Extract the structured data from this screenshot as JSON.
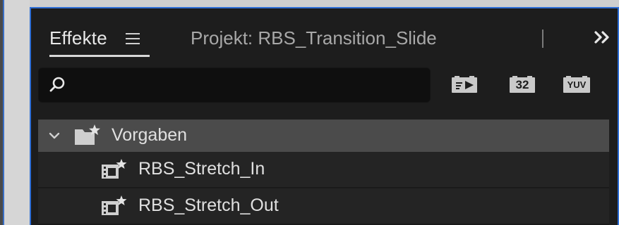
{
  "tabs": {
    "effects_label": "Effekte",
    "project_label": "Projekt: RBS_Transition_Slide"
  },
  "search": {
    "placeholder": "",
    "value": ""
  },
  "filters": {
    "accelerated_label": "",
    "bit32_label": "32",
    "yuv_label": "YUV"
  },
  "tree": {
    "folder_label": "Vorgaben",
    "items": [
      {
        "label": "RBS_Stretch_In"
      },
      {
        "label": "RBS_Stretch_Out"
      }
    ]
  },
  "colors": {
    "panel_bg": "#1d1d1d",
    "accent_border": "#2f6fd6",
    "folder_row_bg": "#4b4b4b"
  }
}
